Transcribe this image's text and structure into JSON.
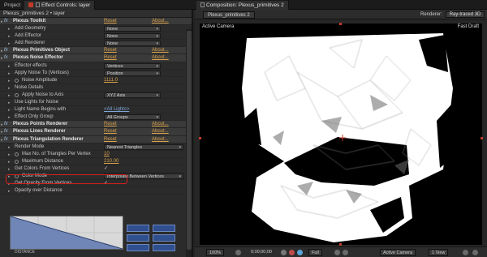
{
  "tabs": {
    "project": "Project",
    "effect_controls": "Effect Controls: layer",
    "composition": "Composition: Plexus_primitives 2"
  },
  "effect_panel": {
    "breadcrumb": "Plexus_primitives 2 • layer",
    "rows": [
      {
        "type": "fx",
        "label": "Plexus Toolkit",
        "reset": "Reset",
        "about": "About..."
      },
      {
        "type": "prop",
        "label": "Add Geometry",
        "value": "None",
        "control": "dropdown"
      },
      {
        "type": "prop",
        "label": "Add Effector",
        "value": "None",
        "control": "dropdown"
      },
      {
        "type": "prop",
        "label": "Add Renderer",
        "value": "None",
        "control": "dropdown"
      },
      {
        "type": "fx",
        "label": "Plexus Primitives Object",
        "reset": "Reset",
        "about": "About..."
      },
      {
        "type": "fx",
        "label": "Plexus Noise Effector",
        "reset": "Reset",
        "about": "About..."
      },
      {
        "type": "prop",
        "label": "Effector effects",
        "value": "Vertices",
        "control": "dropdown"
      },
      {
        "type": "prop",
        "label": "Apply Noise To (Vertices)",
        "value": "Position",
        "control": "dropdown"
      },
      {
        "type": "prop",
        "label": "Noise Amplitude",
        "value": "1111.0",
        "control": "number",
        "stopwatch": true
      },
      {
        "type": "prop",
        "label": "Noise Details",
        "value": "",
        "control": "none"
      },
      {
        "type": "prop",
        "label": "Apply Noise to Axis",
        "value": "XYZ Axis",
        "control": "dropdown",
        "stopwatch": true
      },
      {
        "type": "prop",
        "label": "Use Lights for Noise",
        "value": "",
        "control": "checkbox"
      },
      {
        "type": "prop",
        "label": "Light Name Begins with",
        "value": "<All Lights>",
        "control": "link"
      },
      {
        "type": "prop",
        "label": "Effect Only Group",
        "value": "All Groups",
        "control": "dropdown"
      },
      {
        "type": "fx",
        "label": "Plexus Points Renderer",
        "reset": "Reset",
        "about": "About..."
      },
      {
        "type": "fx",
        "label": "Plexus Lines Renderer",
        "reset": "Reset",
        "about": "About..."
      },
      {
        "type": "fx",
        "label": "Plexus Triangulation Renderer",
        "reset": "Reset",
        "about": "About..."
      },
      {
        "type": "prop",
        "label": "Render Mode",
        "value": "Nearest Triangles",
        "control": "dropdown"
      },
      {
        "type": "prop",
        "label": "Max No. of Triangles Per Vertex",
        "value": "10",
        "control": "number",
        "stopwatch": true
      },
      {
        "type": "prop",
        "label": "Maximum Distance",
        "value": "210.00",
        "control": "number",
        "stopwatch": true
      },
      {
        "type": "prop",
        "label": "Get Colors From Vertices",
        "value": "✓",
        "control": "checkbox"
      },
      {
        "type": "prop",
        "label": "Color Mode",
        "value": "Interpolate Between Vertices",
        "control": "dropdown",
        "stopwatch": true
      },
      {
        "type": "prop",
        "label": "Get Opacity From Vertices",
        "value": "✓",
        "control": "checkbox"
      },
      {
        "type": "prop",
        "label": "Opacity over Distance",
        "value": "",
        "control": "none"
      }
    ],
    "graph_labels": [
      "DISTANCE",
      "",
      "",
      ""
    ]
  },
  "composition_panel": {
    "comp_tab": "Plexus_primitives 2",
    "renderer_label": "Renderer:",
    "renderer_value": "Ray-traced 3D",
    "viewer_left": "Active Camera",
    "viewer_right": "Fast Draft",
    "bottom": {
      "zoom": "100%",
      "timecode": "0;00;00;00",
      "resolution": "Full",
      "camera": "Active Camera",
      "views": "1 View"
    }
  },
  "colors": {
    "accent_link": "#d8a14a",
    "highlight_border": "#d21f1f",
    "marker": "#c23b2a"
  }
}
